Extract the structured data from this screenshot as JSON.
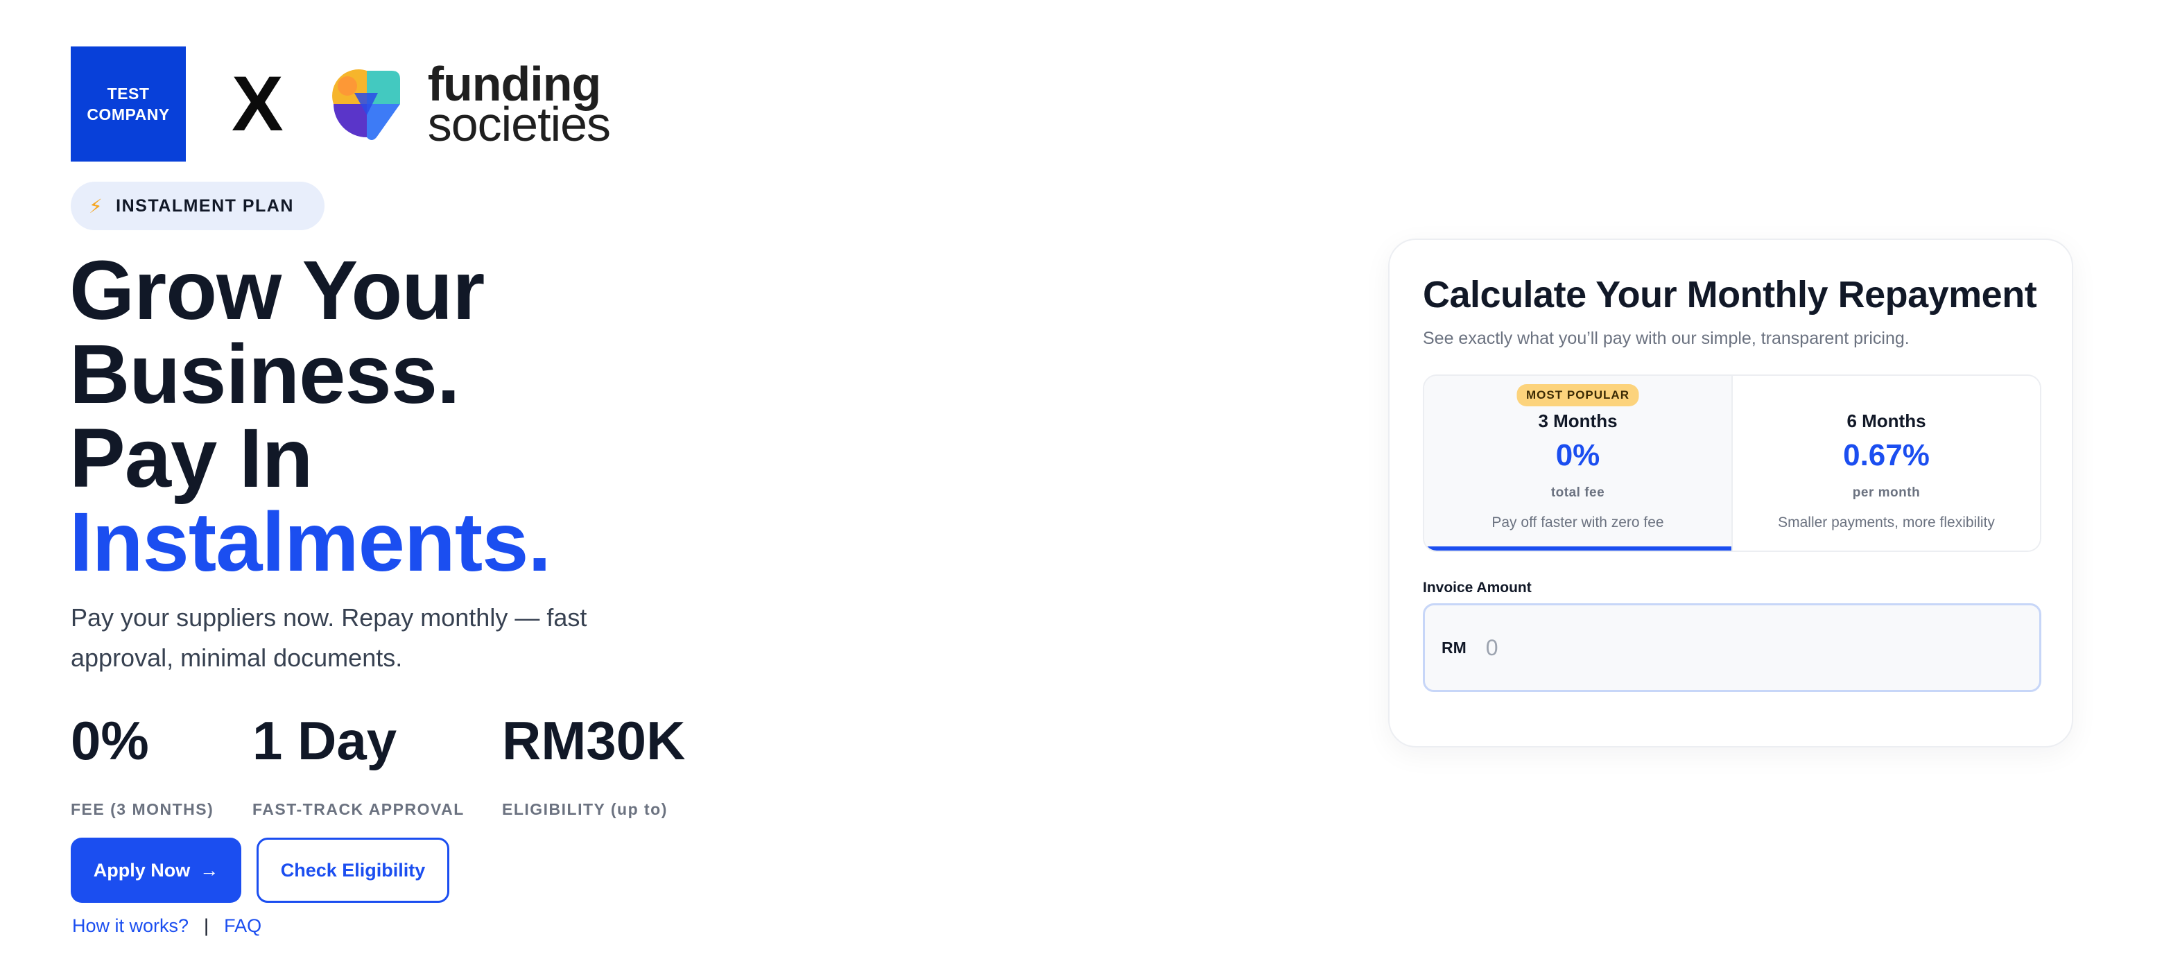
{
  "brand": {
    "partner_logo_text": "TEST COMPANY",
    "partner_logo_line1": "TEST",
    "partner_logo_line2": "COMPANY",
    "cross": "X",
    "fs_line1": "funding",
    "fs_line2": "societies",
    "icon": "funding-societies-logo-mark"
  },
  "pill": {
    "icon": "lightning-bolt-icon",
    "icon_glyph": "⚡",
    "label": "INSTALMENT PLAN"
  },
  "hero": {
    "line1": "Grow Your",
    "line2": "Business.",
    "line3": "Pay In",
    "line4": "Instalments.",
    "subtitle": "Pay your suppliers now. Repay monthly — fast approval, minimal documents."
  },
  "stats": [
    {
      "value": "0%",
      "label": "FEE (3 MONTHS)"
    },
    {
      "value": "1 Day",
      "label": "FAST-TRACK APPROVAL"
    },
    {
      "value": "RM30K",
      "label": "ELIGIBILITY (up to)"
    }
  ],
  "actions": {
    "apply_label": "Apply Now",
    "apply_arrow": "→",
    "check_label": "Check Eligibility"
  },
  "links": {
    "how": "How it works?",
    "separator": "|",
    "faq": "FAQ"
  },
  "calculator": {
    "title": "Calculate Your Monthly Repayment",
    "subtitle": "See exactly what you’ll pay with our simple, transparent pricing.",
    "plans": [
      {
        "badge": "MOST POPULAR",
        "term": "3 Months",
        "rate": "0%",
        "unit": "total fee",
        "desc": "Pay off faster with zero fee",
        "selected": true
      },
      {
        "term": "6 Months",
        "rate": "0.67%",
        "unit": "per month",
        "desc": "Smaller payments, more flexibility",
        "selected": false
      }
    ],
    "invoice_label": "Invoice Amount",
    "currency": "RM",
    "amount_placeholder": "0",
    "amount_value": ""
  },
  "colors": {
    "accent": "#1b4ef0",
    "partner_logo_bg": "#0840d9",
    "badge_bg": "#fcd37c",
    "pill_bg": "#e8eefb",
    "heading": "#111827"
  }
}
